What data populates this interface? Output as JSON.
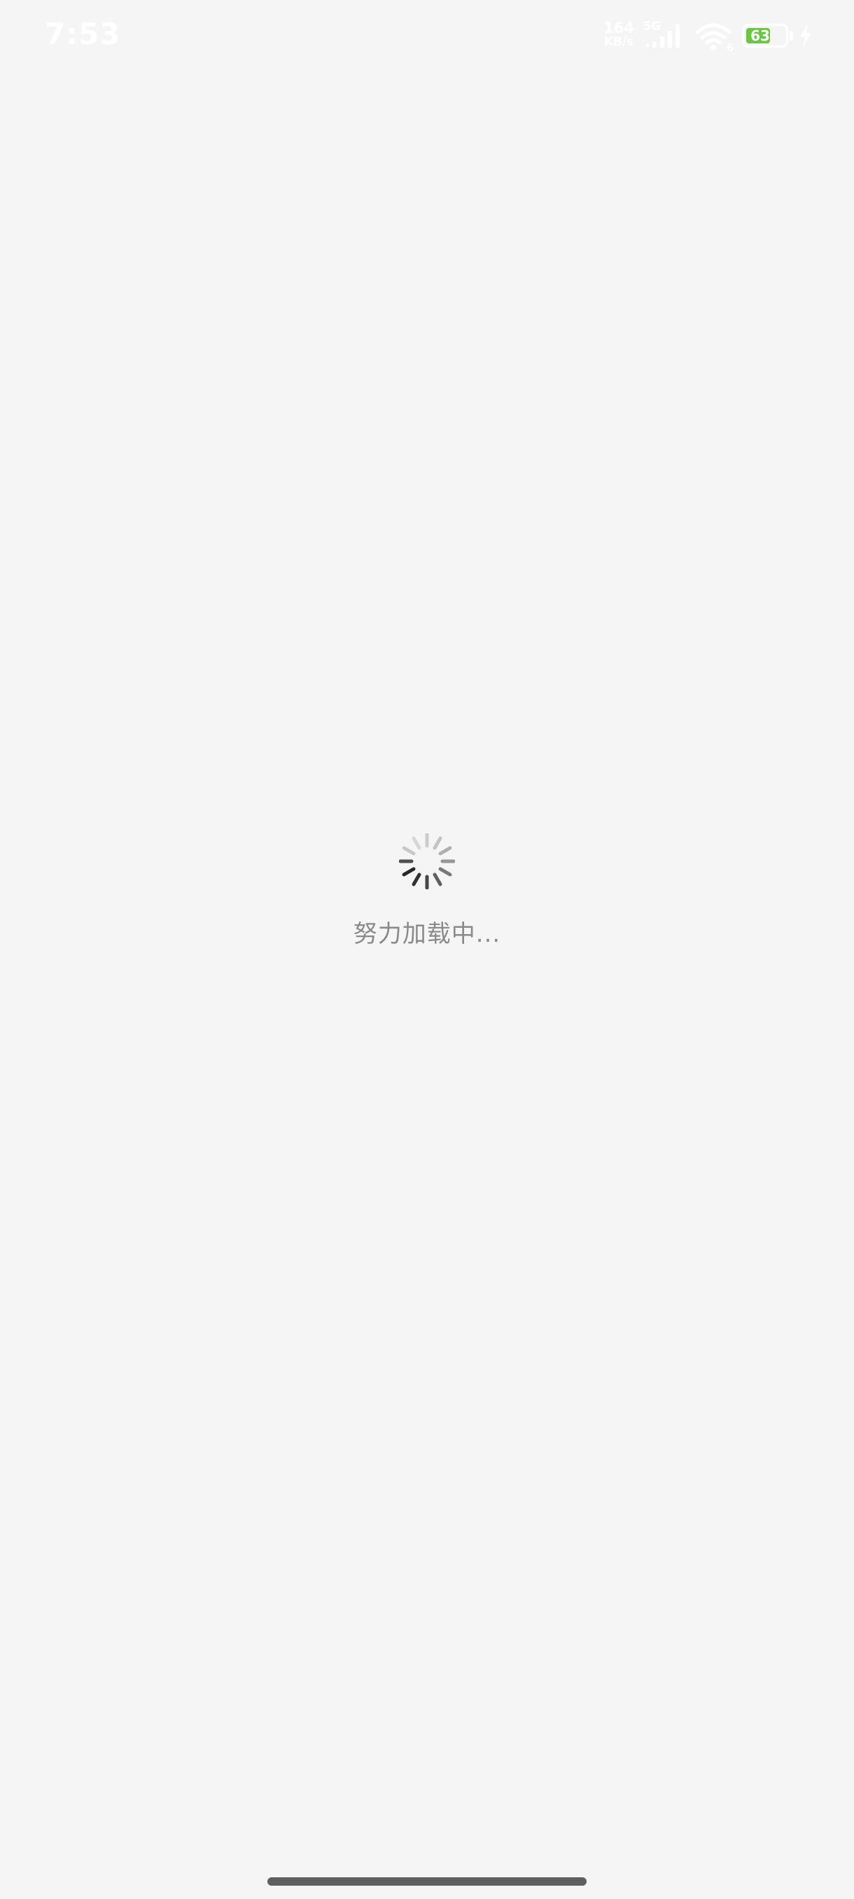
{
  "status_bar": {
    "time": "7:53",
    "net_speed_value": "164",
    "net_speed_unit": "KB/s",
    "network_type": "5G",
    "wifi_badge": "6",
    "battery_level": "63",
    "battery_fraction": 0.63,
    "battery_color": "#6cc644",
    "icons": [
      "signal-bars-icon",
      "wifi-icon",
      "battery-icon",
      "charging-bolt-icon"
    ]
  },
  "loading": {
    "text": "努力加载中...",
    "spinner_icon": "loading-spinner-icon"
  },
  "colors": {
    "background": "#f5f5f5",
    "loading_text": "#8a8a8a",
    "home_indicator": "#5f5f5f"
  }
}
